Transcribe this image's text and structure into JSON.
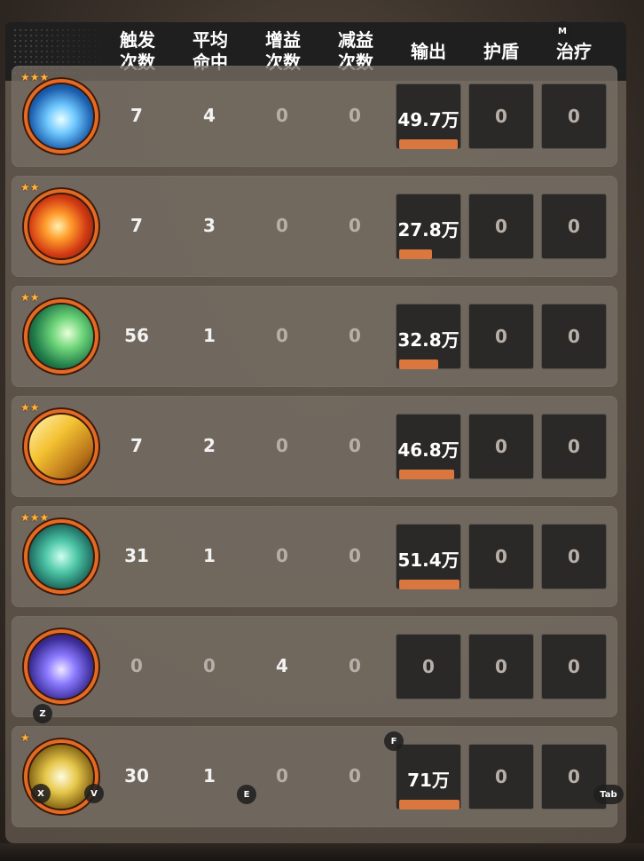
{
  "headers": {
    "trigger": [
      "触发",
      "次数"
    ],
    "avg_hit": [
      "平均",
      "命中"
    ],
    "buff": [
      "增益",
      "次数"
    ],
    "debuff": [
      "减益",
      "次数"
    ],
    "output": "输出",
    "shield": "护盾",
    "heal": "治疗"
  },
  "rows": [
    {
      "icon": "ice-shard-skill-icon",
      "stars": "★★★",
      "trigger": "7",
      "avg_hit": "4",
      "buff": "0",
      "debuff": "0",
      "output": "49.7万",
      "output_fill": 0.97,
      "shield": "0",
      "heal": "0"
    },
    {
      "icon": "fireball-skill-icon",
      "stars": "★★",
      "trigger": "7",
      "avg_hit": "3",
      "buff": "0",
      "debuff": "0",
      "output": "27.8万",
      "output_fill": 0.54,
      "shield": "0",
      "heal": "0"
    },
    {
      "icon": "green-wind-skill-icon",
      "stars": "★★",
      "trigger": "56",
      "avg_hit": "1",
      "buff": "0",
      "debuff": "0",
      "output": "32.8万",
      "output_fill": 0.64,
      "shield": "0",
      "heal": "0"
    },
    {
      "icon": "golden-lightning-skill-icon",
      "stars": "★★",
      "trigger": "7",
      "avg_hit": "2",
      "buff": "0",
      "debuff": "0",
      "output": "46.8万",
      "output_fill": 0.91,
      "shield": "0",
      "heal": "0"
    },
    {
      "icon": "jade-orb-skill-icon",
      "stars": "★★★",
      "trigger": "31",
      "avg_hit": "1",
      "buff": "0",
      "debuff": "0",
      "output": "51.4万",
      "output_fill": 1.0,
      "shield": "0",
      "heal": "0"
    },
    {
      "icon": "starry-vortex-skill-icon",
      "stars": "",
      "trigger": "0",
      "avg_hit": "0",
      "buff": "4",
      "debuff": "0",
      "output": "0",
      "output_fill": 0,
      "shield": "0",
      "heal": "0"
    },
    {
      "icon": "golden-burst-skill-icon",
      "stars": "★",
      "trigger": "30",
      "avg_hit": "1",
      "buff": "0",
      "debuff": "0",
      "output": "71万",
      "output_fill": 1.0,
      "shield": "0",
      "heal": "0"
    }
  ],
  "keys": {
    "m": "M",
    "z": "Z",
    "x": "X",
    "v": "V",
    "e": "E",
    "f": "F",
    "tab": "Tab"
  },
  "colors": {
    "accent": "#d9773f",
    "ring": "#e46a24"
  }
}
